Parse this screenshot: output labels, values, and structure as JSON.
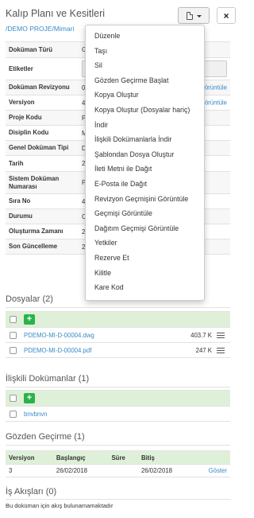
{
  "header": {
    "title": "Kalıp Planı ve Kesitleri",
    "breadcrumb": "/DEMO PROJE/Mimari",
    "close_symbol": "×"
  },
  "metadata": {
    "rows": [
      {
        "label": "Doküman Türü",
        "value": "G",
        "link": ""
      },
      {
        "label": "Etiketler",
        "value": "",
        "link": ""
      },
      {
        "label": "Doküman Revizyonu",
        "value": "0",
        "link": "örüntüle"
      },
      {
        "label": "Versiyon",
        "value": "4",
        "link": "örüntüle"
      },
      {
        "label": "Proje Kodu",
        "value": "P",
        "link": ""
      },
      {
        "label": "Disiplin Kodu",
        "value": "M",
        "link": ""
      },
      {
        "label": "Genel Doküman Tipi",
        "value": "D",
        "link": ""
      },
      {
        "label": "Tarih",
        "value": "2",
        "link": ""
      },
      {
        "label": "Sistem Doküman Numarası",
        "value": "P",
        "link": ""
      },
      {
        "label": "Sıra No",
        "value": "4",
        "link": ""
      },
      {
        "label": "Durumu",
        "value": "C",
        "link": ""
      },
      {
        "label": "Oluşturma Zamanı",
        "value": "2",
        "link": ""
      },
      {
        "label": "Son Güncelleme",
        "value": "2",
        "link": ""
      }
    ]
  },
  "dropdown": {
    "items": [
      "Düzenle",
      "Taşı",
      "Sil",
      "Gözden Geçirme Başlat",
      "Kopya Oluştur",
      "Kopya Oluştur (Dosyalar hariç)",
      "İndir",
      "İlişkili Dokümanlarla İndir",
      "Şablondan Dosya Oluştur",
      "İleti Metni ile Dağıt",
      "E-Posta ile Dağıt",
      "Revizyon Geçmişini Görüntüle",
      "Geçmişi Görüntüle",
      "Dağıtım Geçmişi Görüntüle",
      "Yetkiler",
      "Rezerve Et",
      "Kilitle",
      "Kare Kod"
    ]
  },
  "files": {
    "title": "Dosyalar (2)",
    "add_symbol": "+",
    "items": [
      {
        "name": "PDEMO-MI-D-00004.dwg",
        "size": "403.7 K"
      },
      {
        "name": "PDEMO-MI-D-00004.pdf",
        "size": "247 K"
      }
    ]
  },
  "related": {
    "title": "İlişkili Dokümanlar (1)",
    "add_symbol": "+",
    "items": [
      {
        "name": "bnvbnvn"
      }
    ]
  },
  "review": {
    "title": "Gözden Geçirme (1)",
    "headers": [
      "Versiyon",
      "Başlangıç",
      "Süre",
      "Bitiş"
    ],
    "rows": [
      {
        "version": "3",
        "start": "26/02/2018",
        "duration": "",
        "end": "26/02/2018",
        "action": "Göster"
      }
    ]
  },
  "workflows": {
    "title": "İş Akışları (0)",
    "empty_text": "Bu doküman için akış bulunamamaktadır"
  }
}
